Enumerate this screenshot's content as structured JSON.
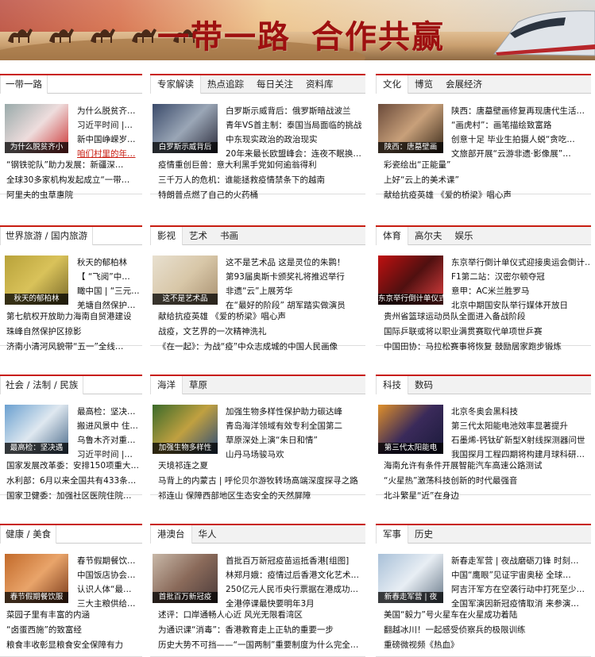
{
  "banner": {
    "title_a": "一带一路",
    "title_b": "合作共赢"
  },
  "colors": {
    "accent": "#c81d11",
    "tab_bg": "#f2f2f2"
  },
  "left": [
    {
      "tab": "一带一路",
      "caption": "为什么脱贫齐小",
      "right": [
        "为什么脱贫齐…",
        "习近平时间 |…",
        "新中国峥嵘岁…",
        "咱们村里的年…"
      ],
      "bottom": [
        "“钢铁驼队”助力发展：新疆深…",
        "全球30多家机构发起成立“一带…",
        "阿里夫的虫草惠院"
      ]
    },
    {
      "tab": "世界旅游 / 国内旅游",
      "caption": "秋天的郁柏林",
      "right": [
        "秋天的郁柏林",
        "【 “飞阅”中…",
        "瞰中国 | “三元…",
        "羌塘自然保护…"
      ],
      "bottom": [
        "第七航权开放助力海南自贸港建设",
        "珠峰自然保护区掠影",
        "济南小清河风貌带“五一”全线…"
      ]
    },
    {
      "tab": "社会 / 法制 / 民族",
      "caption": "最高检：坚决遇",
      "right": [
        "最高检：坚决…",
        "搬进风景中 住…",
        "乌鲁木齐对重…",
        "习近平时间 |…"
      ],
      "bottom": [
        "国家发展改革委：安排150项重大…",
        "水利部：6月以来全国共有433条…",
        "国家卫健委：加强社区医院住院…"
      ]
    },
    {
      "tab": "健康 / 美食",
      "caption": "春节假期餐饮服",
      "right": [
        "春节假期餐饮…",
        "中国饭店协会…",
        "认识人体“最…",
        "三大主粮供给…"
      ],
      "bottom": [
        "菜园子里有丰富的内涵",
        "“卤蛋西施”的致富经",
        "粮食丰收彰显粮食安全保障有力"
      ]
    }
  ],
  "mid": [
    {
      "tabs": [
        "专家解读",
        "热点追踪",
        "每日关注",
        "资料库"
      ],
      "caption": "白罗斯示威背后",
      "right": [
        "白罗斯示威背后：俄罗斯暗战波兰",
        "青年VS首主制：泰国当局面临的挑战",
        "中东现实政治的政治现实",
        "20年来最长欧盟峰会：连夜不眠换…"
      ],
      "bottom": [
        "疫情重创巨兽：意大利黑手党如何逾翁得利",
        "三千万人的危机：谁能拯救疫情禁条下的越南",
        "特朗普点燃了自己的火药桶"
      ]
    },
    {
      "tabs": [
        "影视",
        "艺术",
        "书画"
      ],
      "caption": "这不是艺术品",
      "right": [
        "这不是艺术品 这是灵位的朱鹮！",
        "第93届奥斯卡颁奖礼将推迟举行",
        "非遗“云”上展芳华",
        "在“最好的阶段” 胡军踏实做演员"
      ],
      "bottom": [
        "献给抗疫英雄 《爱的桥梁》唱心声",
        "战疫，文艺界的一次精神洗礼",
        "《在一起》：为战“疫”中众志成城的中国人民画像"
      ]
    },
    {
      "tabs": [
        "海洋",
        "草原"
      ],
      "caption": "加强生物多样性",
      "right": [
        "加强生物多样性保护助力碳达峰",
        "青岛海洋领域有效专利全国第二",
        "草原深处上演“朱日和情”",
        "山丹马场骏马欢"
      ],
      "bottom": [
        "天境祁连之夏",
        "马背上的内蒙古 | 呼伦贝尔游牧转场高端深度探寻之路",
        "祁连山 保障西部地区生态安全的天然屏障"
      ]
    },
    {
      "tabs": [
        "港澳台",
        "华人"
      ],
      "caption": "首批百万新冠疫",
      "right": [
        "首批百万新冠疫苗运抵香港[组图]",
        "林郑月娥：疫情过后香港文化艺术…",
        "250亿元人民币央行票据在港成功…",
        "全港停课最快要明年3月"
      ],
      "bottom": [
        "述评：口岸通畅人心近 风光无限看湾区",
        "为通识课“消毒”：香港教育走上正轨的重要一步",
        "历史大势不可挡——“一国两制”重要制度为什么完全…"
      ]
    }
  ],
  "right": [
    {
      "tabs": [
        "文化",
        "博览",
        "会展经济"
      ],
      "caption": "陕西：唐墓壁画",
      "right": [
        "陕西：唐墓壁画修复再现唐代生活…",
        "“画虎村”：画笔描绘致富路",
        "创意十足 毕业生拍摄人蜕“贪吃…",
        "文旅部开展“云游非遗·影像展”…"
      ],
      "bottom": [
        "彩瓷绘出“正能量”",
        "上好“云上的美术课”",
        "献给抗疫英雄 《爱的桥梁》唱心声"
      ]
    },
    {
      "tabs": [
        "体育",
        "高尔夫",
        "娱乐"
      ],
      "caption": "东京举行倒计单仪式",
      "right": [
        "东京举行倒计单仪式迎接奥运会倒计…",
        "F1第二站：汉密尔顿夺冠",
        "意甲：AC米兰胜罗马",
        "北京中期国安队举行媒体开放日"
      ],
      "bottom": [
        "贵州省篮球运动员队全面进入备战阶段",
        "国际乒联或将以职业满贯赛取代单项世乒赛",
        "中国田协：马拉松赛事将恢复 鼓励居家跑步锻炼"
      ]
    },
    {
      "tabs": [
        "科技",
        "数码"
      ],
      "caption": "第三代太阳能电",
      "right": [
        "北京冬奥会黑科技",
        "第三代太阳能电池效率显著提升",
        "石墨烯-钙钛矿新型X射线探测器问世",
        "我国探月工程四期将构建月球科研…"
      ],
      "bottom": [
        "海南允许有条件开展智能汽车高速公路测试",
        "“火星热”激荡科技创新的时代最强音",
        "北斗繁星“近”在身边"
      ]
    },
    {
      "tabs": [
        "军事",
        "历史"
      ],
      "caption": "新春走军营 | 夜",
      "right": [
        "新春走军营 | 夜战磨砺刀锋 时刻…",
        "中国“鹰眼”见证宇宙奥秘 全球…",
        "阿吉汗军方在空袭行动中打死至少…",
        "全国军演因新冠疫情取消 来参演…"
      ],
      "bottom": [
        "美国“毅力”号火星车在火星成功着陆",
        "翻越冰川！一起感受侦察兵的极限训练",
        "重磅微视频《热血》"
      ]
    }
  ]
}
